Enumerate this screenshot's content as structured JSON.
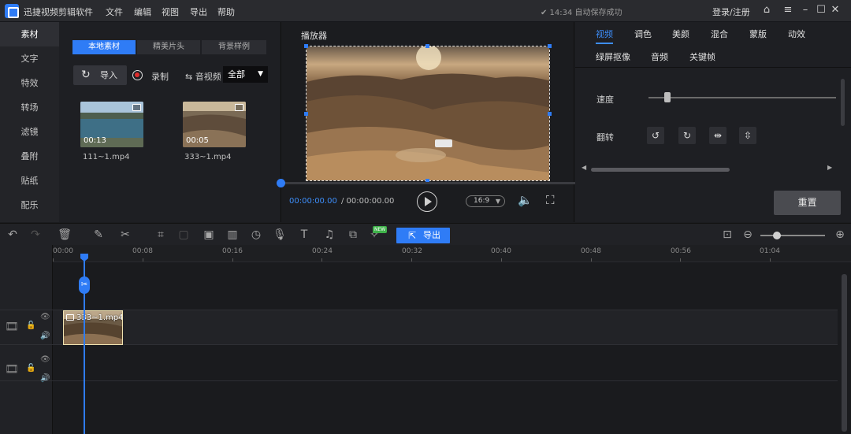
{
  "app": {
    "title": "迅捷视频剪辑软件",
    "menu": [
      "文件",
      "编辑",
      "视图",
      "导出",
      "帮助"
    ],
    "autosave": "✔ 14:34 自动保存成功",
    "login": "登录/注册"
  },
  "leftnav": {
    "items": [
      "素材",
      "文字",
      "特效",
      "转场",
      "滤镜",
      "叠附",
      "贴纸",
      "配乐"
    ],
    "active": 0
  },
  "media": {
    "tabs": [
      "本地素材",
      "精美片头",
      "背景样例"
    ],
    "import_label": "导入",
    "record_label": "录制",
    "audio_label": "音视频",
    "filter_value": "全部",
    "items": [
      {
        "name": "111~1.mp4",
        "duration": "00:13"
      },
      {
        "name": "333~1.mp4",
        "duration": "00:05"
      }
    ]
  },
  "player": {
    "title": "播放器",
    "time_current": "00:00:00.00",
    "time_total": "/ 00:00:00.00",
    "ratio": "16:9"
  },
  "props": {
    "tabs_row1": [
      "视频",
      "调色",
      "美颜",
      "混合",
      "蒙版",
      "动效"
    ],
    "tabs_row2": [
      "绿屏抠像",
      "音频",
      "关键帧"
    ],
    "active_tab": "视频",
    "speed_label": "速度",
    "speed_level": 0.1,
    "flip_label": "翻转",
    "reset_label": "重置"
  },
  "toolbar": {
    "export_label": "导出",
    "new_badge": "NEW",
    "zoom_level": 0.25
  },
  "timeline": {
    "ticks": [
      "00:00",
      "00:08",
      "00:16",
      "00:24",
      "00:32",
      "00:40",
      "00:48",
      "00:56",
      "01:04"
    ],
    "clip_label": "333~1.mp4"
  }
}
